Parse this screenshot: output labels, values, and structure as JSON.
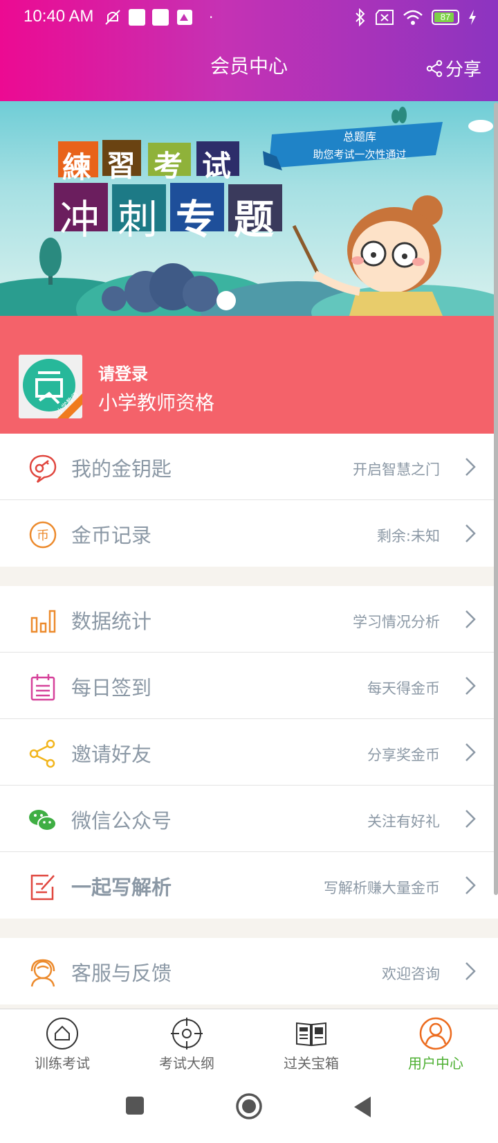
{
  "status_bar": {
    "time": "10:40 AM",
    "battery": "87"
  },
  "header": {
    "title": "会员中心",
    "share_label": "分享"
  },
  "banner": {
    "chars_top": [
      "練",
      "習",
      "考",
      "试"
    ],
    "chars_bottom": [
      "冲",
      "刺",
      "专",
      "题"
    ],
    "ribbon_line1": "总题库",
    "ribbon_line2": "助您考试一次性通过"
  },
  "profile": {
    "login_label": "请登录",
    "subject": "小学教师资格",
    "avatar_tag": "小学教师"
  },
  "menu_group1": [
    {
      "icon": "key-icon",
      "label": "我的金钥匙",
      "hint": "开启智慧之门"
    },
    {
      "icon": "coin-icon",
      "label": "金币记录",
      "hint": "剩余:未知"
    }
  ],
  "menu_group2": [
    {
      "icon": "bar-chart-icon",
      "label": "数据统计",
      "hint": "学习情况分析"
    },
    {
      "icon": "calendar-icon",
      "label": "每日签到",
      "hint": "每天得金币"
    },
    {
      "icon": "share-icon",
      "label": "邀请好友",
      "hint": "分享奖金币"
    },
    {
      "icon": "wechat-icon",
      "label": "微信公众号",
      "hint": "关注有好礼"
    },
    {
      "icon": "edit-icon",
      "label": "一起写解析",
      "hint": "写解析赚大量金币"
    }
  ],
  "menu_group3": [
    {
      "icon": "support-icon",
      "label": "客服与反馈",
      "hint": "欢迎咨询"
    }
  ],
  "tabs": [
    {
      "icon": "home-icon",
      "label": "训练考试"
    },
    {
      "icon": "target-icon",
      "label": "考试大纲"
    },
    {
      "icon": "book-icon",
      "label": "过关宝箱"
    },
    {
      "icon": "user-icon",
      "label": "用户中心"
    }
  ],
  "colors": {
    "accent": "#4caf31",
    "profile_bg": "#f4626a",
    "header_start": "#ec0a92",
    "header_end": "#8c34c0"
  }
}
